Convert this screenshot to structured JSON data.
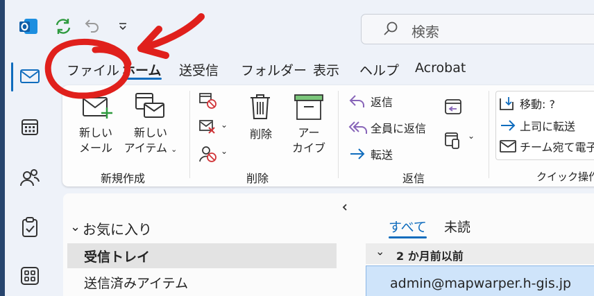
{
  "search": {
    "placeholder": "検索"
  },
  "tabs": [
    {
      "label": "ファイル"
    },
    {
      "label": "ホーム"
    },
    {
      "label": "送受信"
    },
    {
      "label": "フォルダー"
    },
    {
      "label": "表示"
    },
    {
      "label": "ヘルプ"
    },
    {
      "label": "Acrobat"
    }
  ],
  "ribbon": {
    "new_group": {
      "new_mail": [
        "新しい",
        "メール"
      ],
      "new_item": [
        "新しい",
        "アイテム"
      ],
      "label": "新規作成"
    },
    "delete_group": {
      "delete": "削除",
      "archive": [
        "アー",
        "カイブ"
      ],
      "label": "削除"
    },
    "reply_group": {
      "reply": "返信",
      "reply_all": "全員に返信",
      "forward": "転送",
      "label": "返信"
    },
    "quick_group": {
      "move": "移動: ?",
      "to_manager": "上司に転送",
      "team_email": "チーム宛て電子",
      "label": "クイック操作"
    }
  },
  "folders": {
    "favorites": "お気に入り",
    "inbox": "受信トレイ",
    "sent": "送信済みアイテム"
  },
  "messages": {
    "filter_all": "すべて",
    "filter_unread": "未読",
    "group_header": "2 か月前以前",
    "first_sender": "admin@mapwarper.h-gis.jp"
  },
  "colors": {
    "accent": "#0f6cbd",
    "annotation_red": "#e0201c",
    "selected_folder": "#e3e3e3",
    "selected_message": "#cfe4fa"
  }
}
